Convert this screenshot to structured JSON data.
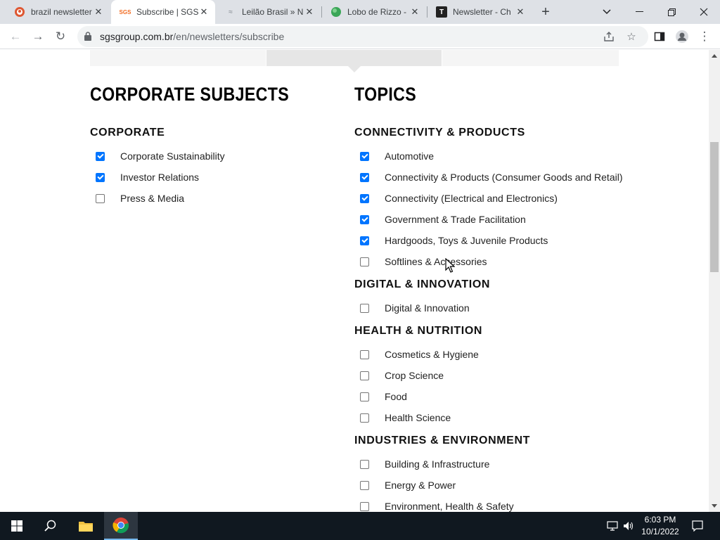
{
  "browser": {
    "tabs": [
      {
        "title": "brazil newsletter",
        "favicon": "duckduckgo-icon",
        "active": false
      },
      {
        "title": "Subscribe | SGS",
        "favicon": "sgs-icon",
        "active": true
      },
      {
        "title": "Leilão Brasil » N",
        "favicon": "leilao-icon",
        "active": false
      },
      {
        "title": "Lobo de Rizzo -",
        "favicon": "lobo-icon",
        "active": false
      },
      {
        "title": "Newsletter - Ch",
        "favicon": "t-icon",
        "active": false
      }
    ],
    "url_host": "sgsgroup.com.br",
    "url_path": "/en/newsletters/subscribe",
    "accent_color": "#0075ff"
  },
  "left_column": {
    "title": "CORPORATE SUBJECTS",
    "groups": [
      {
        "title": "CORPORATE",
        "items": [
          {
            "label": "Corporate Sustainability",
            "checked": true
          },
          {
            "label": "Investor Relations",
            "checked": true
          },
          {
            "label": "Press & Media",
            "checked": false
          }
        ]
      }
    ]
  },
  "right_column": {
    "title": "TOPICS",
    "groups": [
      {
        "title": "CONNECTIVITY & PRODUCTS",
        "items": [
          {
            "label": "Automotive",
            "checked": true
          },
          {
            "label": "Connectivity & Products (Consumer Goods and Retail)",
            "checked": true
          },
          {
            "label": "Connectivity (Electrical and Electronics)",
            "checked": true
          },
          {
            "label": "Government & Trade Facilitation",
            "checked": true
          },
          {
            "label": "Hardgoods, Toys & Juvenile Products",
            "checked": true
          },
          {
            "label": "Softlines & Accessories",
            "checked": false
          }
        ]
      },
      {
        "title": "DIGITAL & INNOVATION",
        "items": [
          {
            "label": "Digital & Innovation",
            "checked": false
          }
        ]
      },
      {
        "title": "HEALTH & NUTRITION",
        "items": [
          {
            "label": "Cosmetics & Hygiene",
            "checked": false
          },
          {
            "label": "Crop Science",
            "checked": false
          },
          {
            "label": "Food",
            "checked": false
          },
          {
            "label": "Health Science",
            "checked": false
          }
        ]
      },
      {
        "title": "INDUSTRIES & ENVIRONMENT",
        "items": [
          {
            "label": "Building & Infrastructure",
            "checked": false
          },
          {
            "label": "Energy & Power",
            "checked": false
          },
          {
            "label": "Environment, Health & Safety",
            "checked": false
          }
        ]
      }
    ]
  },
  "taskbar": {
    "time": "6:03 PM",
    "date": "10/1/2022"
  }
}
